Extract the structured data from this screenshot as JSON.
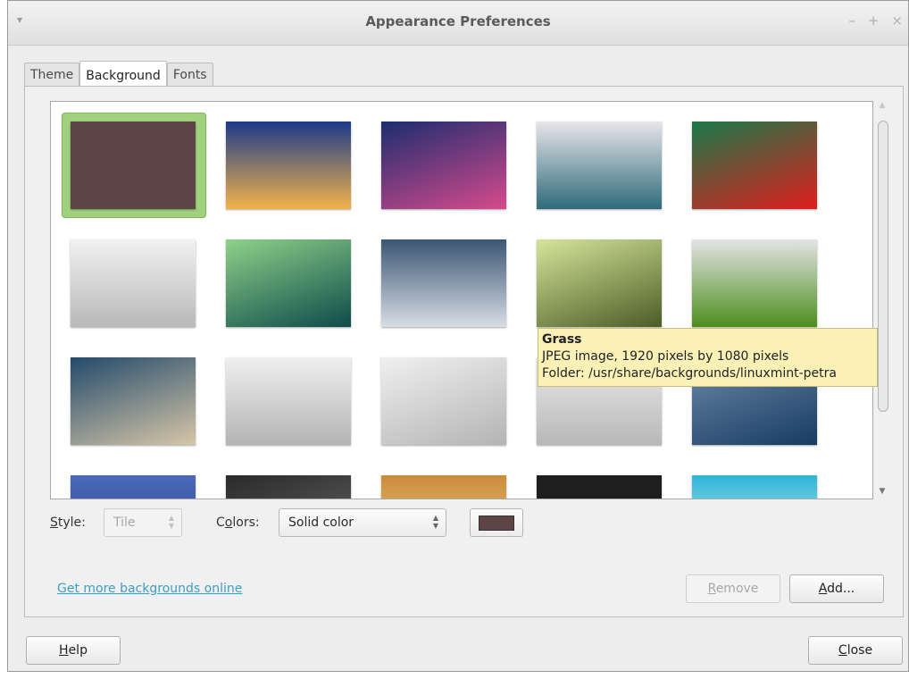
{
  "window": {
    "title": "Appearance Preferences",
    "menu_glyph": "▾",
    "minimize": "–",
    "maximize": "+",
    "close": "×"
  },
  "tabs": [
    {
      "label": "Theme"
    },
    {
      "label": "Background"
    },
    {
      "label": "Fonts"
    }
  ],
  "thumbnails": [
    {
      "name": "solid-color",
      "colors": [
        "#5d4545",
        "#5d4545"
      ],
      "selected": true
    },
    {
      "name": "sunset-horizon",
      "colors": [
        "#1b3a8a",
        "#f2b24a"
      ]
    },
    {
      "name": "water-reflection",
      "colors": [
        "#1c2d6e",
        "#d64a8c"
      ]
    },
    {
      "name": "cherry-blossom",
      "colors": [
        "#e8e6ea",
        "#2e6b7a"
      ]
    },
    {
      "name": "color-stripes",
      "colors": [
        "#1a7a4a",
        "#e01e1e"
      ]
    },
    {
      "name": "mint-logo-3d",
      "colors": [
        "#f1f1f1",
        "#b9b9b9"
      ]
    },
    {
      "name": "green-blur",
      "colors": [
        "#8fd18a",
        "#0e4b4a"
      ]
    },
    {
      "name": "sun-through-trees",
      "colors": [
        "#3b5673",
        "#d8dde5"
      ]
    },
    {
      "name": "grass",
      "colors": [
        "#d7e59a",
        "#4a5d26"
      ]
    },
    {
      "name": "green-streaks",
      "colors": [
        "#e4e4e4",
        "#4c8d1c"
      ]
    },
    {
      "name": "blue-blur",
      "colors": [
        "#234a6a",
        "#d6c6a8"
      ]
    },
    {
      "name": "mint-logo-3d-2",
      "colors": [
        "#f0f0f0",
        "#b4b4b4"
      ]
    },
    {
      "name": "mint-logo-3d-3",
      "colors": [
        "#f0f0f0",
        "#b4b4b4"
      ]
    },
    {
      "name": "mint-logo-small",
      "colors": [
        "#e9e9e9",
        "#b8b8b8"
      ]
    },
    {
      "name": "lake-pier",
      "colors": [
        "#6b8aa8",
        "#173b62"
      ]
    },
    {
      "name": "blue-gradient",
      "colors": [
        "#4a6ab8",
        "#2a3f88"
      ]
    },
    {
      "name": "dark-scene",
      "colors": [
        "#2a2a2a",
        "#6a6a6a"
      ]
    },
    {
      "name": "orange-sky",
      "colors": [
        "#c98b3c",
        "#f7d98a"
      ]
    },
    {
      "name": "black",
      "colors": [
        "#1e1e1e",
        "#1e1e1e"
      ]
    },
    {
      "name": "cyan-blur",
      "colors": [
        "#2fb5d6",
        "#e6f3f8"
      ]
    }
  ],
  "tooltip": {
    "title": "Grass",
    "line2": "JPEG image, 1920 pixels by 1080 pixels",
    "line3": "Folder: /usr/share/backgrounds/linuxmint-petra"
  },
  "style": {
    "label_prefix": "S",
    "label_rest": "tyle:",
    "value": "Tile"
  },
  "colors": {
    "label_prefix": "C",
    "label_mid": "o",
    "label_rest": "lors:",
    "value": "Solid color",
    "swatch": "#5d4545"
  },
  "link": "Get more backgrounds online",
  "buttons": {
    "remove_u": "R",
    "remove_rest": "emove",
    "add_u": "A",
    "add_rest": "dd...",
    "help_u": "H",
    "help_rest": "elp",
    "close_u": "C",
    "close_rest": "lose"
  }
}
